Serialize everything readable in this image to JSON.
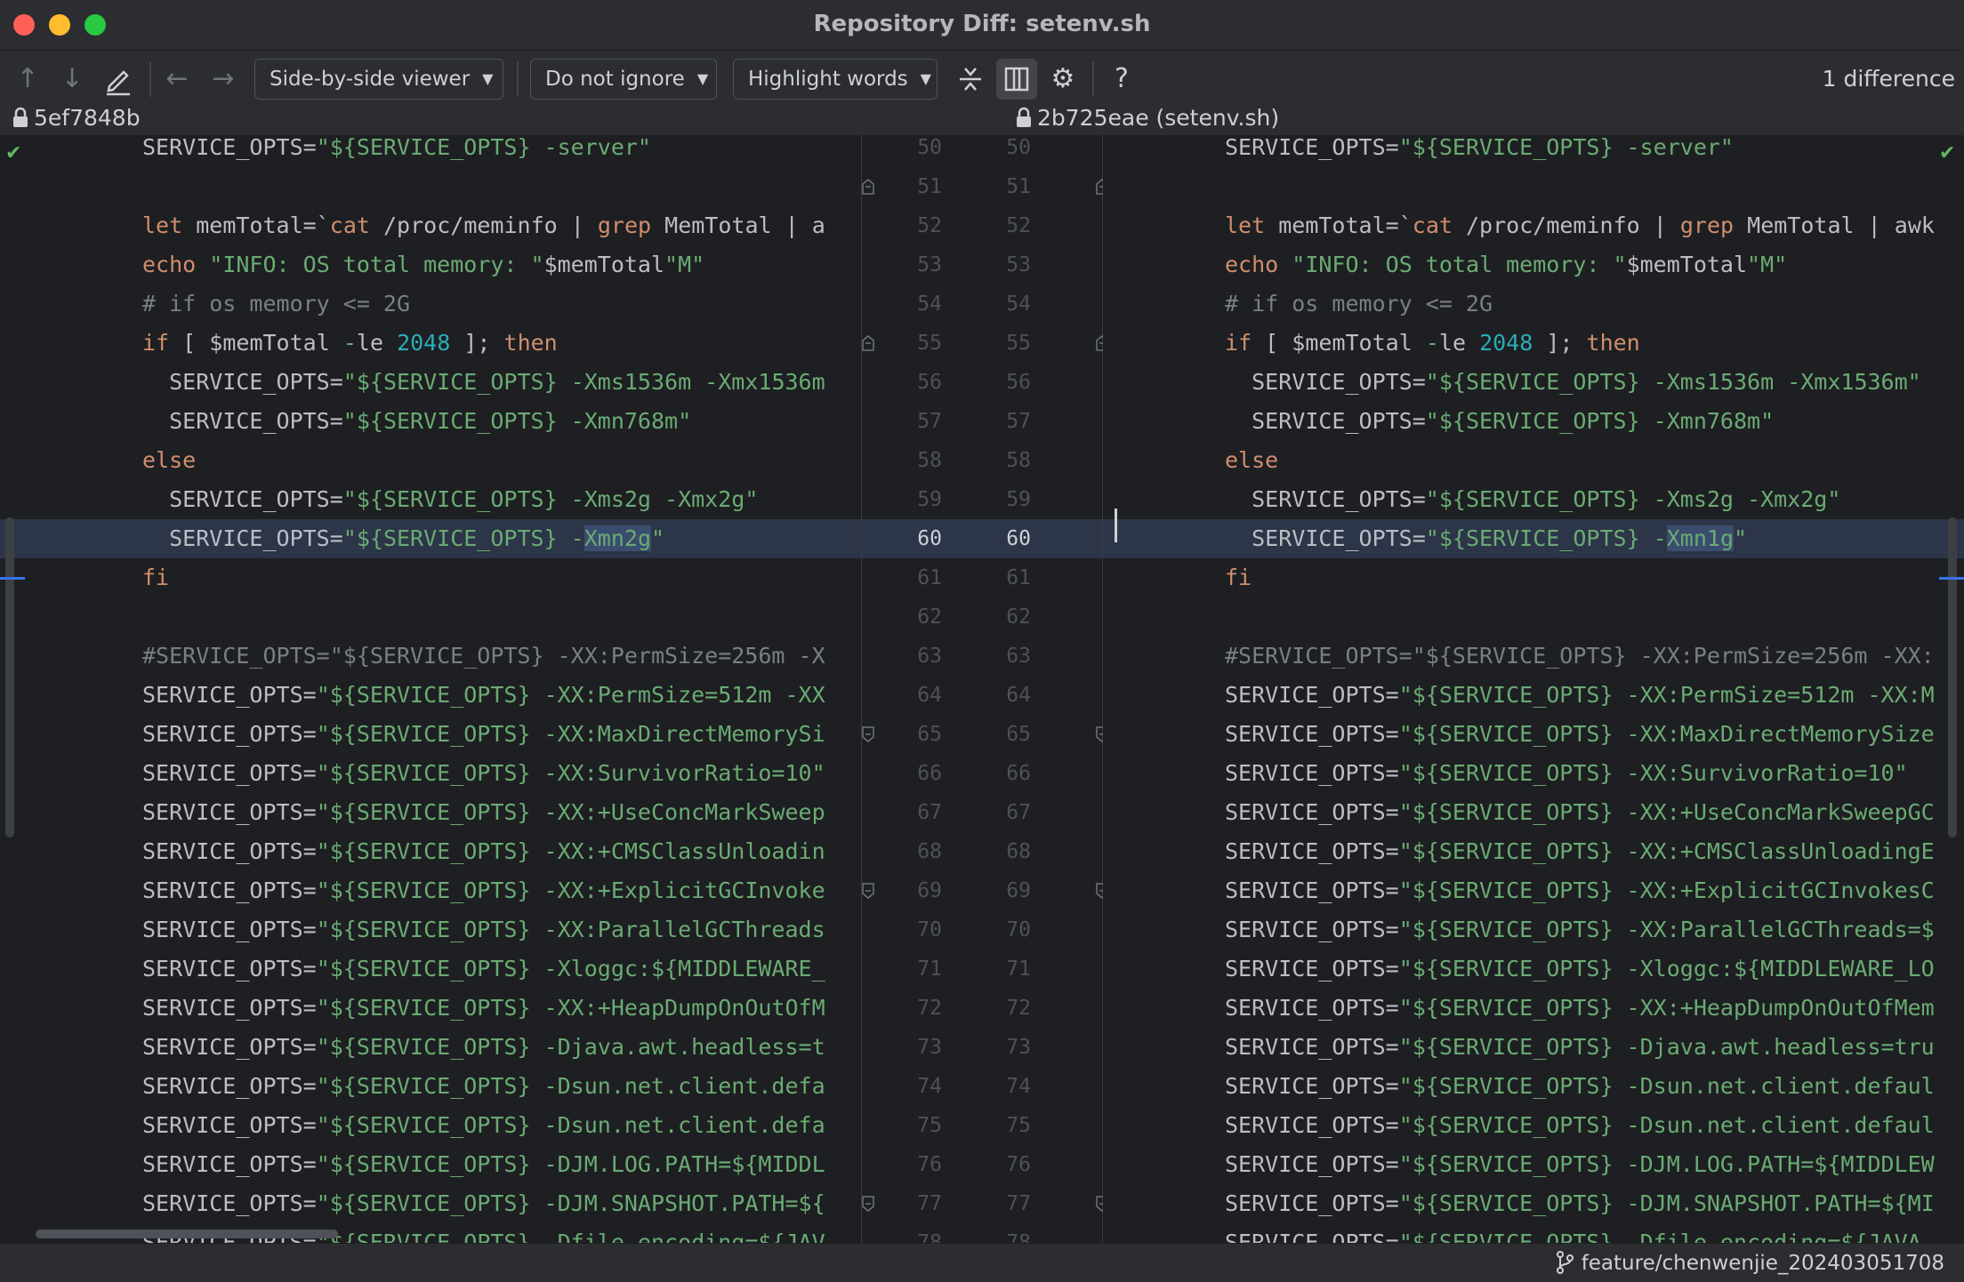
{
  "window": {
    "title": "Repository Diff: setenv.sh"
  },
  "toolbar": {
    "viewer_mode": "Side-by-side viewer",
    "ignore_mode": "Do not ignore",
    "highlight_mode": "Highlight words",
    "difference_count": "1 difference",
    "help": "?"
  },
  "files": {
    "left_revision": "5ef7848b",
    "right_revision": "2b725eae (setenv.sh)"
  },
  "diff": {
    "line_numbers": [
      "50",
      "51",
      "52",
      "53",
      "54",
      "55",
      "56",
      "57",
      "58",
      "59",
      "60",
      "61",
      "62",
      "63",
      "64",
      "65",
      "66",
      "67",
      "68",
      "69",
      "70",
      "71",
      "72",
      "73",
      "74",
      "75",
      "76",
      "77",
      "78"
    ],
    "left_lines": [
      "SERVICE_OPTS=\"${SERVICE_OPTS} -server\"",
      "",
      "let memTotal=`cat /proc/meminfo | grep MemTotal | a",
      "echo \"INFO: OS total memory: \"$memTotal\"M\"",
      "# if os memory <= 2G",
      "if [ $memTotal -le 2048 ]; then",
      "  SERVICE_OPTS=\"${SERVICE_OPTS} -Xms1536m -Xmx1536m",
      "  SERVICE_OPTS=\"${SERVICE_OPTS} -Xmn768m\"",
      "else",
      "  SERVICE_OPTS=\"${SERVICE_OPTS} -Xms2g -Xmx2g\"",
      "  SERVICE_OPTS=\"${SERVICE_OPTS} -Xmn2g\"",
      "fi",
      "",
      "#SERVICE_OPTS=\"${SERVICE_OPTS} -XX:PermSize=256m -X",
      "SERVICE_OPTS=\"${SERVICE_OPTS} -XX:PermSize=512m -XX",
      "SERVICE_OPTS=\"${SERVICE_OPTS} -XX:MaxDirectMemorySi",
      "SERVICE_OPTS=\"${SERVICE_OPTS} -XX:SurvivorRatio=10\"",
      "SERVICE_OPTS=\"${SERVICE_OPTS} -XX:+UseConcMarkSweep",
      "SERVICE_OPTS=\"${SERVICE_OPTS} -XX:+CMSClassUnloadin",
      "SERVICE_OPTS=\"${SERVICE_OPTS} -XX:+ExplicitGCInvoke",
      "SERVICE_OPTS=\"${SERVICE_OPTS} -XX:ParallelGCThreads",
      "SERVICE_OPTS=\"${SERVICE_OPTS} -Xloggc:${MIDDLEWARE_",
      "SERVICE_OPTS=\"${SERVICE_OPTS} -XX:+HeapDumpOnOutOfM",
      "SERVICE_OPTS=\"${SERVICE_OPTS} -Djava.awt.headless=t",
      "SERVICE_OPTS=\"${SERVICE_OPTS} -Dsun.net.client.defa",
      "SERVICE_OPTS=\"${SERVICE_OPTS} -Dsun.net.client.defa",
      "SERVICE_OPTS=\"${SERVICE_OPTS} -DJM.LOG.PATH=${MIDDL",
      "SERVICE_OPTS=\"${SERVICE_OPTS} -DJM.SNAPSHOT.PATH=${",
      "SERVICE_OPTS=\"${SERVICE_OPTS} -Dfile.encoding=${JAV"
    ],
    "right_lines": [
      "SERVICE_OPTS=\"${SERVICE_OPTS} -server\"",
      "",
      "let memTotal=`cat /proc/meminfo | grep MemTotal | awk",
      "echo \"INFO: OS total memory: \"$memTotal\"M\"",
      "# if os memory <= 2G",
      "if [ $memTotal -le 2048 ]; then",
      "  SERVICE_OPTS=\"${SERVICE_OPTS} -Xms1536m -Xmx1536m\"",
      "  SERVICE_OPTS=\"${SERVICE_OPTS} -Xmn768m\"",
      "else",
      "  SERVICE_OPTS=\"${SERVICE_OPTS} -Xms2g -Xmx2g\"",
      "  SERVICE_OPTS=\"${SERVICE_OPTS} -Xmn1g\"",
      "fi",
      "",
      "#SERVICE_OPTS=\"${SERVICE_OPTS} -XX:PermSize=256m -XX:",
      "SERVICE_OPTS=\"${SERVICE_OPTS} -XX:PermSize=512m -XX:M",
      "SERVICE_OPTS=\"${SERVICE_OPTS} -XX:MaxDirectMemorySize",
      "SERVICE_OPTS=\"${SERVICE_OPTS} -XX:SurvivorRatio=10\"",
      "SERVICE_OPTS=\"${SERVICE_OPTS} -XX:+UseConcMarkSweepGC",
      "SERVICE_OPTS=\"${SERVICE_OPTS} -XX:+CMSClassUnloadingE",
      "SERVICE_OPTS=\"${SERVICE_OPTS} -XX:+ExplicitGCInvokesC",
      "SERVICE_OPTS=\"${SERVICE_OPTS} -XX:ParallelGCThreads=$",
      "SERVICE_OPTS=\"${SERVICE_OPTS} -Xloggc:${MIDDLEWARE_LO",
      "SERVICE_OPTS=\"${SERVICE_OPTS} -XX:+HeapDumpOnOutOfMem",
      "SERVICE_OPTS=\"${SERVICE_OPTS} -Djava.awt.headless=tru",
      "SERVICE_OPTS=\"${SERVICE_OPTS} -Dsun.net.client.defaul",
      "SERVICE_OPTS=\"${SERVICE_OPTS} -Dsun.net.client.defaul",
      "SERVICE_OPTS=\"${SERVICE_OPTS} -DJM.LOG.PATH=${MIDDLEW",
      "SERVICE_OPTS=\"${SERVICE_OPTS} -DJM.SNAPSHOT.PATH=${MI",
      "SERVICE_OPTS=\"${SERVICE_OPTS} -Dfile.encoding=${JAVA_"
    ],
    "changed_line": "60",
    "changed_left_word": "Xmn2g",
    "changed_right_word": "Xmn1g"
  },
  "statusbar": {
    "branch": "feature/chenwenjie_202403051708"
  },
  "colors": {
    "keyword": "#cf8e6d",
    "string": "#6aab73",
    "number": "#2aacb8",
    "comment": "#7a7e85",
    "changed_line_bg": "#2d3548",
    "changed_word_bg": "#3a4d6e"
  },
  "icons": [
    "prev-difference-icon",
    "next-difference-icon",
    "edit-icon",
    "back-icon",
    "forward-icon",
    "collapse-unchanged-icon",
    "sync-scroll-icon",
    "gear-icon",
    "help-icon",
    "lock-icon",
    "checkmark-icon",
    "fold-marker-icon",
    "branch-icon"
  ]
}
